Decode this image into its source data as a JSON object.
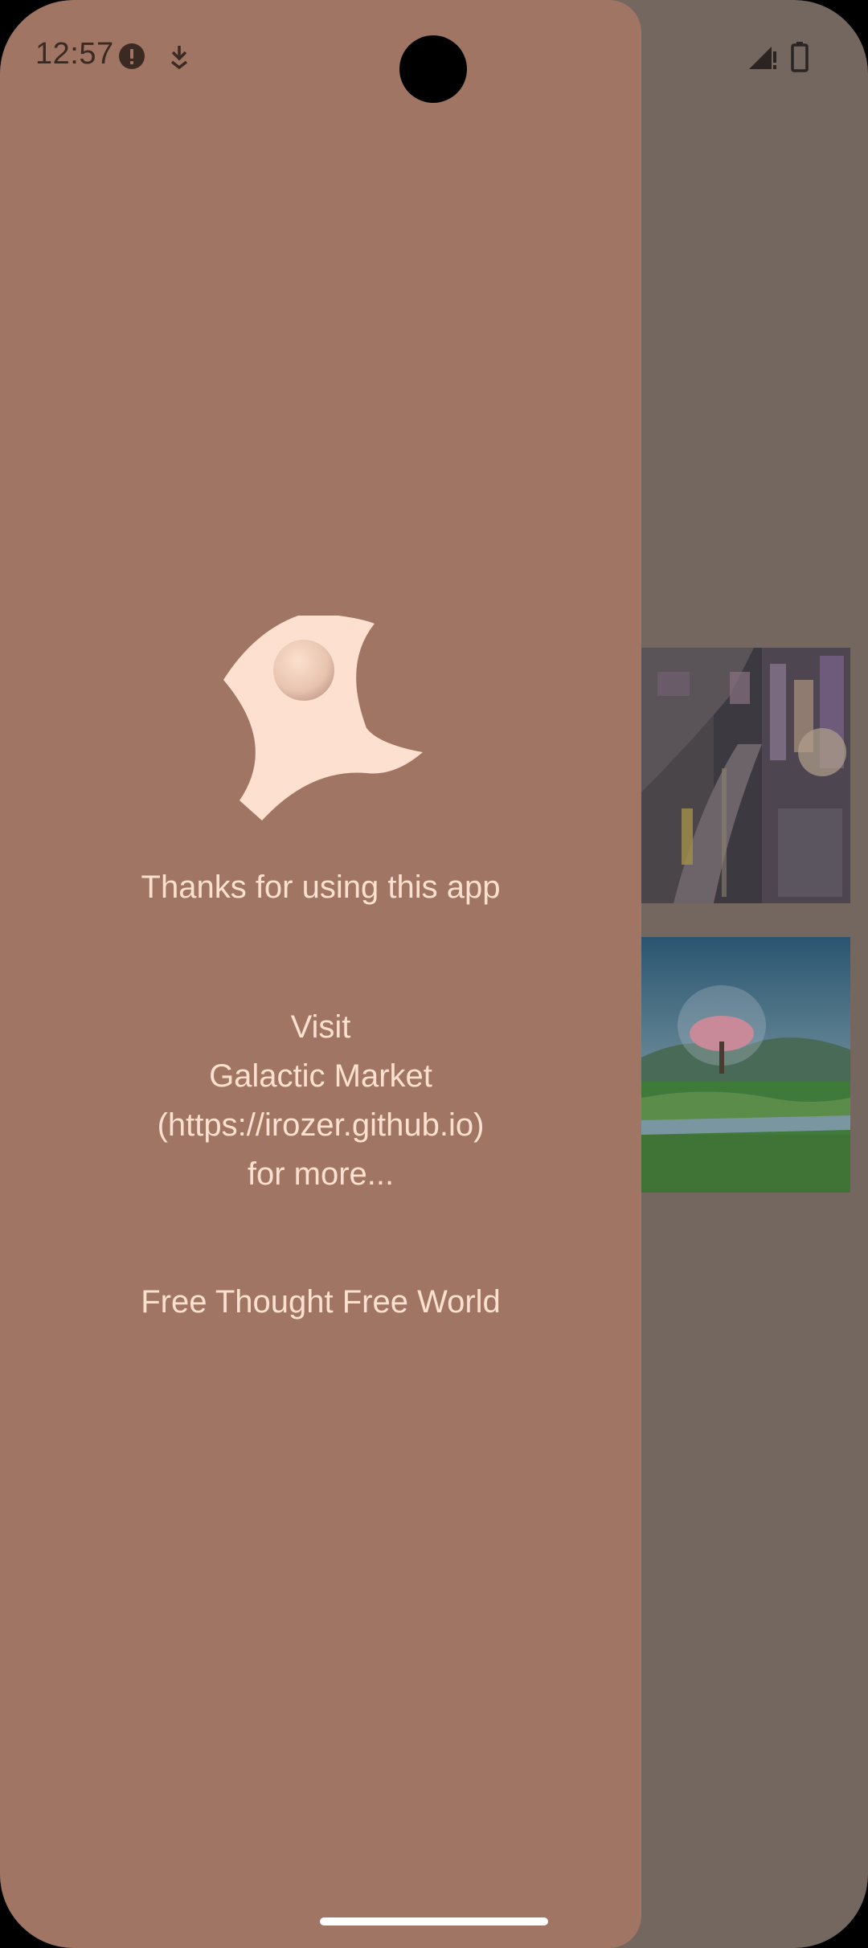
{
  "status_bar": {
    "time": "12:57",
    "icons": [
      "alert-icon",
      "download-icon",
      "signal-icon",
      "battery-icon"
    ]
  },
  "drawer": {
    "logo": "galactic-market-logo",
    "thanks": "Thanks for using this app",
    "visit_lines": [
      "Visit",
      "Galactic Market",
      "(https://irozer.github.io)",
      "for more..."
    ],
    "slogan": "Free Thought Free World"
  },
  "background": {
    "thumbnails": [
      "city-night-image",
      "nature-dome-tree-image"
    ]
  },
  "colors": {
    "drawer_bg": "#a07563",
    "scrim": "#736760",
    "text": "#fde0cf",
    "status_text": "#3b2a22",
    "logo": "#fde0cf"
  }
}
